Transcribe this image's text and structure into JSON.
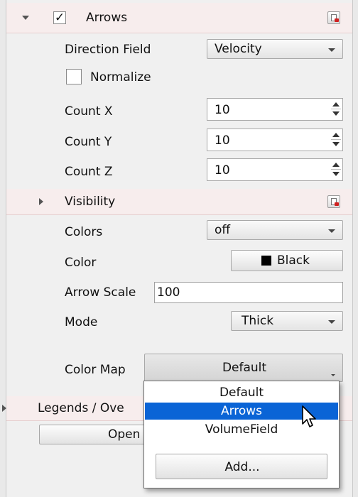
{
  "arrows": {
    "enabled_check": "✓",
    "title": "Arrows",
    "direction_field_label": "Direction Field",
    "direction_field_value": "Velocity",
    "normalize_label": "Normalize",
    "count_x_label": "Count X",
    "count_x_value": "10",
    "count_y_label": "Count Y",
    "count_y_value": "10",
    "count_z_label": "Count Z",
    "count_z_value": "10"
  },
  "visibility": {
    "title": "Visibility",
    "colors_label": "Colors",
    "colors_value": "off",
    "color_label": "Color",
    "color_value": "Black",
    "color_swatch": "#000000",
    "arrow_scale_label": "Arrow Scale",
    "arrow_scale_value": "100",
    "mode_label": "Mode",
    "mode_value": "Thick",
    "color_map_label": "Color Map",
    "color_map_value": "Default"
  },
  "legends": {
    "title": "Legends / Ove",
    "open_button_label": "Open C"
  },
  "dropdown": {
    "options": [
      "Default",
      "Arrows",
      "VolumeField"
    ],
    "selected": "Arrows",
    "add_label": "Add...",
    "highlight_color": "#0a64d6"
  },
  "icons": [
    "expand-down-icon",
    "expand-right-icon",
    "reset-page-icon",
    "cursor-icon"
  ]
}
